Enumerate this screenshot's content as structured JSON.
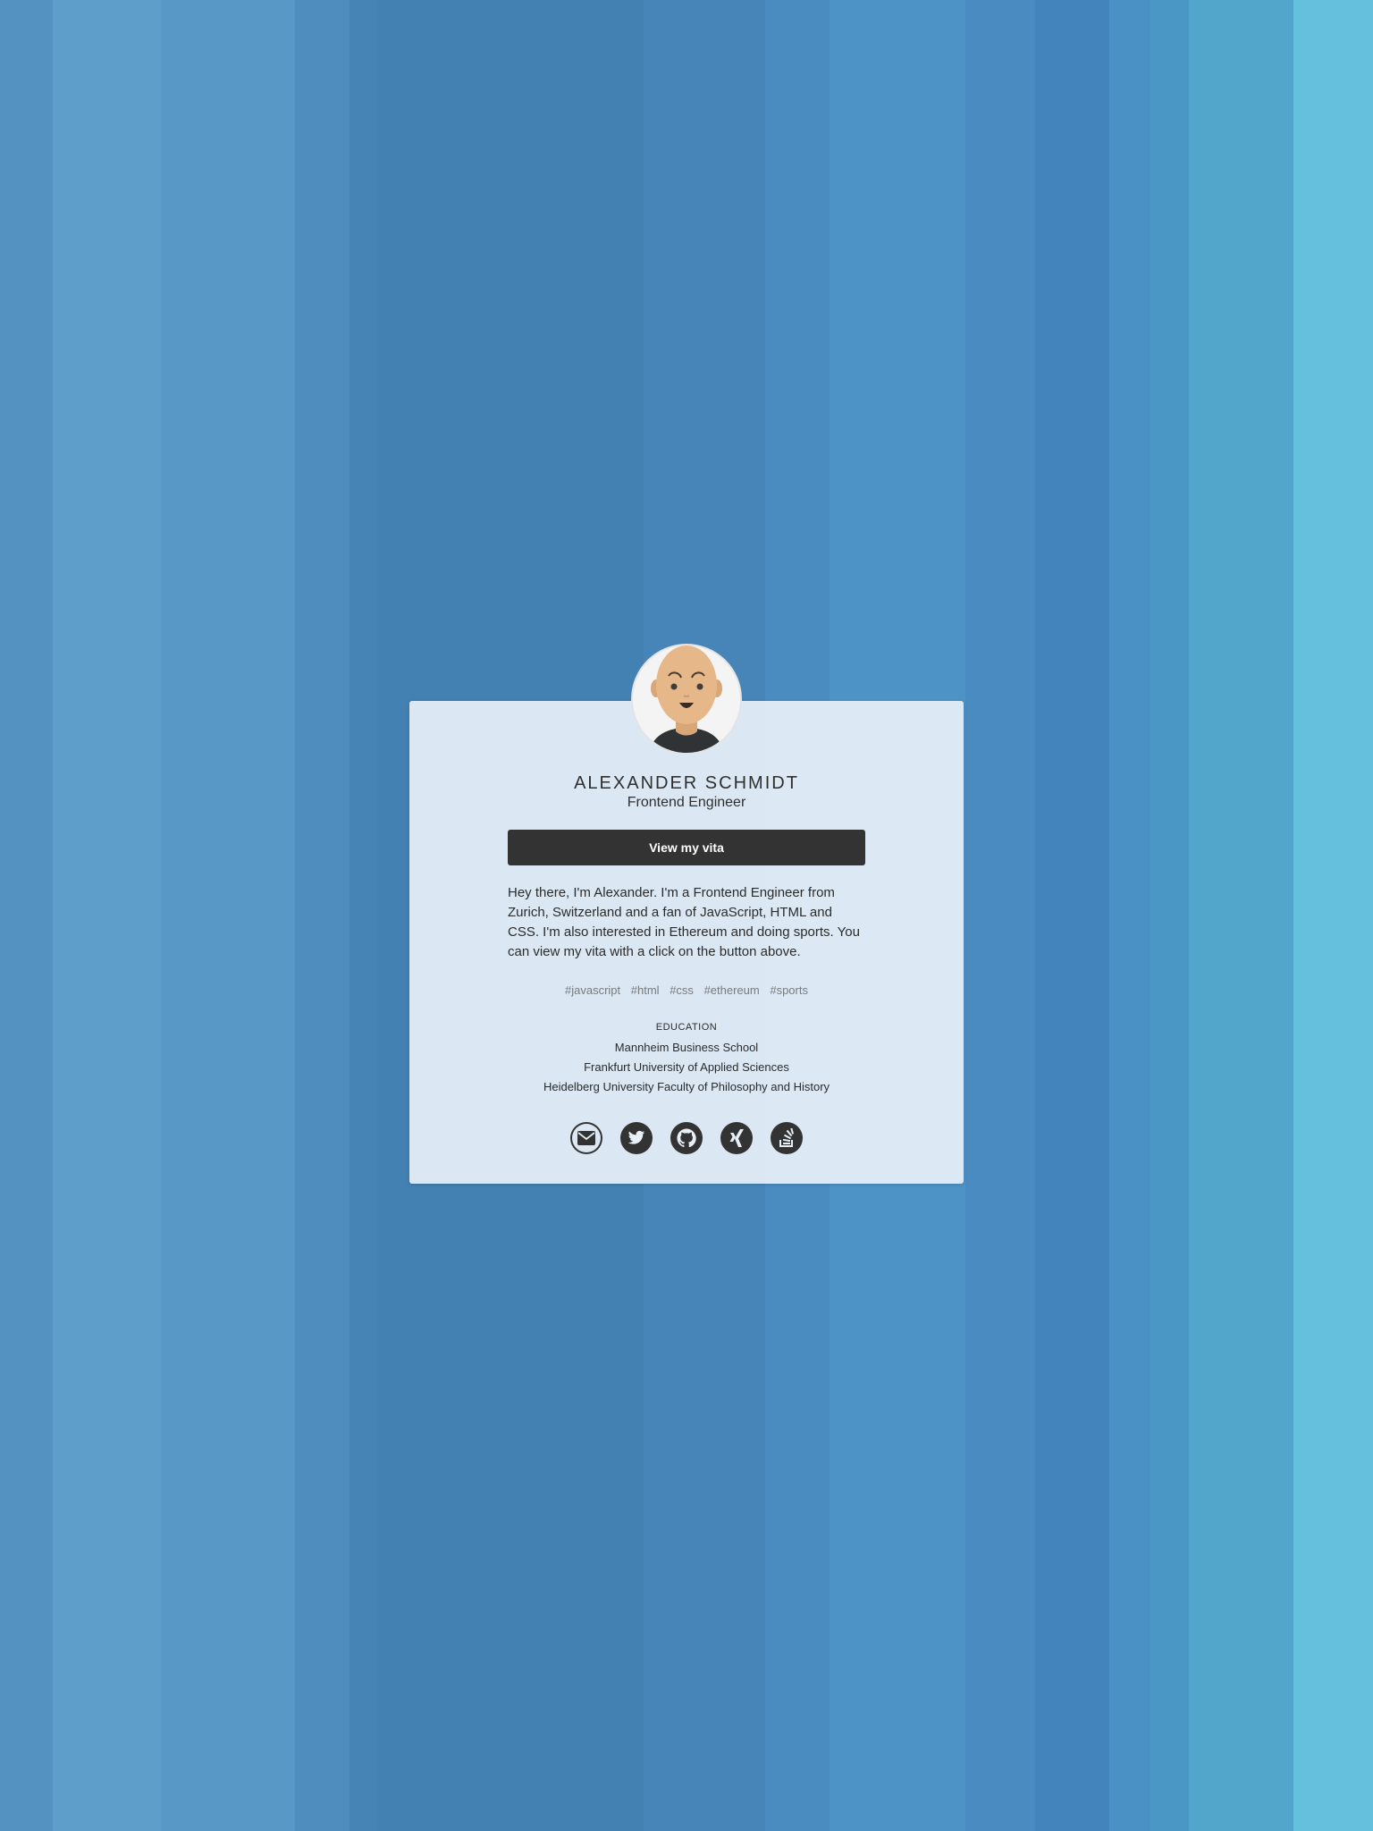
{
  "profile": {
    "name": "ALEXANDER SCHMIDT",
    "title": "Frontend Engineer",
    "vita_button": "View my vita",
    "bio": "Hey there, I'm Alexander. I'm a Frontend Engineer from Zurich, Switzerland and a fan of JavaScript, HTML and CSS. I'm also interested in Ethereum and doing sports. You can view my vita with a click on the button above."
  },
  "tags": [
    "#javascript",
    "#html",
    "#css",
    "#ethereum",
    "#sports"
  ],
  "education": {
    "heading": "EDUCATION",
    "items": [
      "Mannheim Business School",
      "Frankfurt University of Applied Sciences",
      "Heidelberg University Faculty of Philosophy and History"
    ]
  },
  "socials": [
    "mail-icon",
    "twitter-icon",
    "github-icon",
    "xing-icon",
    "stackoverflow-icon"
  ],
  "colors": {
    "card": "#e8f0f7",
    "button": "#333333",
    "tag_text": "#7a7a7a"
  }
}
